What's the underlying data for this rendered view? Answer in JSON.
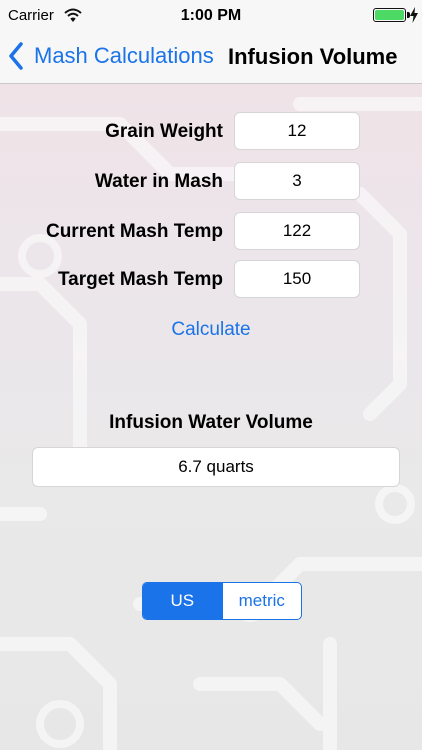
{
  "status_bar": {
    "carrier": "Carrier",
    "time": "1:00 PM",
    "battery_level": 1.0,
    "battery_color": "#4cd964"
  },
  "nav": {
    "back_label": "Mash Calculations",
    "title": "Infusion Volume",
    "accent_color": "#1a73e8"
  },
  "form": {
    "fields": [
      {
        "label": "Grain Weight",
        "value": "12"
      },
      {
        "label": "Water in Mash",
        "value": "3"
      },
      {
        "label": "Current Mash Temp",
        "value": "122"
      },
      {
        "label": "Target Mash Temp",
        "value": "150"
      }
    ],
    "calculate_label": "Calculate"
  },
  "result": {
    "title": "Infusion Water Volume",
    "value": "6.7 quarts"
  },
  "units": {
    "options": [
      "US",
      "metric"
    ],
    "selected": "US"
  },
  "icons": {
    "wifi": "wifi-icon",
    "battery": "battery-icon",
    "charging": "bolt-icon",
    "back": "chevron-left-icon"
  }
}
